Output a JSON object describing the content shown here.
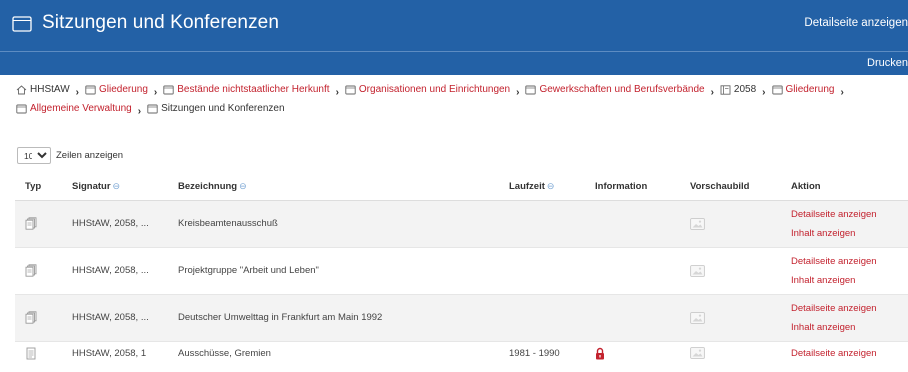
{
  "header": {
    "title": "Sitzungen und Konferenzen",
    "detail_link": "Detailseite anzeigen",
    "print_link": "Drucken"
  },
  "breadcrumb": [
    {
      "label": "HHStAW",
      "kind": "home",
      "link": false
    },
    {
      "label": "Gliederung",
      "kind": "folder",
      "link": true
    },
    {
      "label": "Bestände nichtstaatlicher Herkunft",
      "kind": "folder",
      "link": true
    },
    {
      "label": "Organisationen und Einrichtungen",
      "kind": "folder",
      "link": true
    },
    {
      "label": "Gewerkschaften und Berufsverbände",
      "kind": "folder",
      "link": true
    },
    {
      "label": "2058",
      "kind": "book",
      "link": false
    },
    {
      "label": "Gliederung",
      "kind": "folder",
      "link": true
    },
    {
      "label": "Allgemeine Verwaltung",
      "kind": "folder",
      "link": true
    },
    {
      "label": "Sitzungen und Konferenzen",
      "kind": "folder",
      "link": false
    }
  ],
  "page_size": {
    "selected": "10",
    "label": "Zeilen anzeigen"
  },
  "table": {
    "columns": [
      "Typ",
      "Signatur",
      "Bezeichnung",
      "Laufzeit",
      "Information",
      "Vorschaubild",
      "Aktion"
    ],
    "sortable": [
      false,
      true,
      true,
      true,
      false,
      false,
      false
    ],
    "rows": [
      {
        "type": "group",
        "signatur": "HHStAW, 2058, ...",
        "bezeichnung": "Kreisbeamtenausschuß",
        "laufzeit": "",
        "locked": false,
        "actions": [
          "Detailseite anzeigen",
          "Inhalt anzeigen"
        ]
      },
      {
        "type": "group",
        "signatur": "HHStAW, 2058, ...",
        "bezeichnung": "Projektgruppe \"Arbeit und Leben\"",
        "laufzeit": "",
        "locked": false,
        "actions": [
          "Detailseite anzeigen",
          "Inhalt anzeigen"
        ]
      },
      {
        "type": "group",
        "signatur": "HHStAW, 2058, ...",
        "bezeichnung": "Deutscher Umwelttag in Frankfurt am Main 1992",
        "laufzeit": "",
        "locked": false,
        "actions": [
          "Detailseite anzeigen",
          "Inhalt anzeigen"
        ]
      },
      {
        "type": "file",
        "signatur": "HHStAW, 2058, 1",
        "bezeichnung": "Ausschüsse, Gremien",
        "laufzeit": "1981 - 1990",
        "locked": true,
        "actions": [
          "Detailseite anzeigen"
        ]
      }
    ]
  },
  "colors": {
    "header_bg": "#2361a6",
    "link": "#c3222e",
    "lock": "#c3222e",
    "row_shade": "#f3f3f3"
  },
  "icons": {
    "header": "folder-icon",
    "home": "home-icon",
    "folder": "folder-icon",
    "book": "book-icon",
    "group_type": "stacked-documents-icon",
    "file_type": "document-icon",
    "preview": "image-placeholder-icon",
    "info": "lock-icon"
  }
}
